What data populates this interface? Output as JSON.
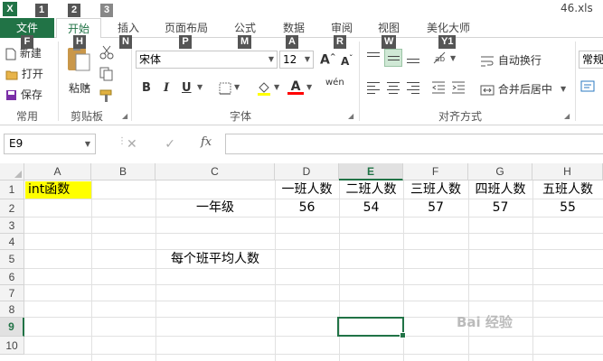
{
  "window": {
    "app_icon": "X",
    "file_name": "46.xls"
  },
  "tabs": [
    {
      "label": "文件"
    },
    {
      "label": "开始"
    },
    {
      "label": "插入"
    },
    {
      "label": "页面布局"
    },
    {
      "label": "公式"
    },
    {
      "label": "数据"
    },
    {
      "label": "审阅"
    },
    {
      "label": "视图"
    },
    {
      "label": "美化大师"
    }
  ],
  "keytips": {
    "quick_1": "1",
    "quick_2": "2",
    "quick_3": "3",
    "file": "F",
    "home": "H",
    "insert": "N",
    "page_layout": "P",
    "formulas": "M",
    "data": "A",
    "review": "R",
    "view": "W",
    "beautify": "Y1"
  },
  "ribbon": {
    "new_label": "新建",
    "open_label": "打开",
    "save_label": "保存",
    "common_group": "常用",
    "paste_label": "粘贴",
    "clipboard_group": "剪贴板",
    "font_name": "宋体",
    "font_size": "12",
    "grow_font": "A",
    "shrink_font": "A",
    "bold": "B",
    "italic": "I",
    "underline": "U",
    "font_color_letter": "A",
    "phonetic": "wén",
    "font_group": "字体",
    "wrap_text": "自动换行",
    "merge_center": "合并后居中",
    "alignment_group": "对齐方式",
    "number_format": "常规"
  },
  "formula_bar": {
    "name_box": "E9",
    "fx_label": "fx",
    "formula": ""
  },
  "colors": {
    "excel_green": "#217346",
    "highlight_yellow": "#ffff00",
    "font_color_red": "#ff0000"
  },
  "columns": [
    "A",
    "B",
    "C",
    "D",
    "E",
    "F",
    "G",
    "H"
  ],
  "rows": [
    "1",
    "2",
    "3",
    "4",
    "5",
    "6",
    "7",
    "8",
    "9",
    "10"
  ],
  "cells": {
    "A1": "int函数",
    "C2": "一年级",
    "C5": "每个班平均人数",
    "D1": "一班人数",
    "E1": "二班人数",
    "F1": "三班人数",
    "G1": "四班人数",
    "H1": "五班人数",
    "D2": "56",
    "E2": "54",
    "F2": "57",
    "G2": "57",
    "H2": "55"
  },
  "selected_cell": "E9",
  "watermark": "Bai 经验"
}
